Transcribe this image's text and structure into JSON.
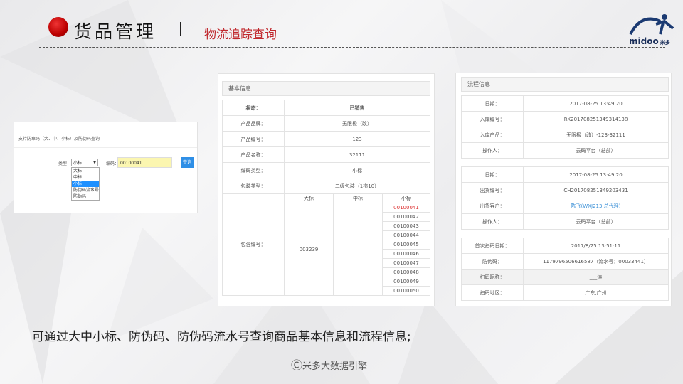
{
  "header": {
    "title": "货品管理",
    "subtitle": "物流追踪查询"
  },
  "logo": {
    "text": "midoo",
    "suffix": "米多"
  },
  "search_panel": {
    "heading": "支持防窜码（大、中、小标）及防伪码查询",
    "type_label": "类型：",
    "type_value": "小标",
    "options": [
      "大标",
      "中标",
      "小标",
      "防伪码流水号",
      "防伪码"
    ],
    "code_label": "编码：",
    "code_value": "00100041",
    "query_button": "查询"
  },
  "basic_info": {
    "title": "基本信息",
    "rows": [
      {
        "k": "状态：",
        "v": "已销售"
      },
      {
        "k": "产品品牌：",
        "v": "无限极（改）"
      },
      {
        "k": "产品编号：",
        "v": "123"
      },
      {
        "k": "产品名称：",
        "v": "32111"
      },
      {
        "k": "编码类型：",
        "v": "小标"
      },
      {
        "k": "包装类型：",
        "v": "二级包装（1拖10）"
      }
    ],
    "pack_label": "包含编号：",
    "pack_headers": [
      "大标",
      "中标",
      "小标"
    ],
    "big_code": "003239",
    "small_codes": [
      "00100041",
      "00100042",
      "00100043",
      "00100044",
      "00100045",
      "00100046",
      "00100047",
      "00100048",
      "00100049",
      "00100050"
    ]
  },
  "process_info": {
    "title": "流程信息",
    "group1": [
      {
        "k": "日期：",
        "v": "2017-08-25 13:49:20"
      },
      {
        "k": "入库编号：",
        "v": "RK201708251349314138"
      },
      {
        "k": "入库产品：",
        "v": "无限极（改）-123-32111"
      },
      {
        "k": "操作人：",
        "v": "云码平台（总部）"
      }
    ],
    "group2": [
      {
        "k": "日期：",
        "v": "2017-08-25 13:49:20"
      },
      {
        "k": "出货编号：",
        "v": "CH201708251349203431"
      },
      {
        "k": "出货客户：",
        "v": "陈飞(WXJ213,总代理)"
      },
      {
        "k": "操作人：",
        "v": "云码平台（总部）"
      }
    ],
    "group3": [
      {
        "k": "首次扫码日期：",
        "v": "2017/8/25 13:51:11"
      },
      {
        "k": "防伪码：",
        "v": "1179796506616587（流水号：00033441）"
      },
      {
        "k": "扫码昵称：",
        "v": "___涛"
      },
      {
        "k": "扫码地区：",
        "v": "广东,广州"
      }
    ]
  },
  "caption": "可通过大中小标、防伪码、防伪码流水号查询商品基本信息和流程信息;",
  "copyright": {
    "symbol": "C",
    "text": "米多大数据引擎"
  }
}
